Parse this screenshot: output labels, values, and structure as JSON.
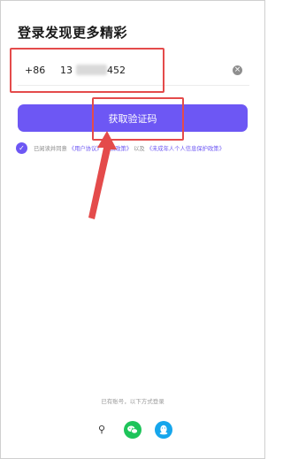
{
  "login": {
    "title": "登录发现更多精彩",
    "country_code": "+86",
    "phone_head": "13",
    "phone_tail": "452",
    "get_code_label": "获取验证码",
    "agreement": {
      "prefix": "已阅读并同意",
      "user_agreement": "《用户协议》",
      "privacy_policy": "隐私政策》",
      "and": "以及",
      "minor_policy": "《未成年人个人信息保护政策》"
    },
    "alt_login_hint": "已有账号，以下方式登录"
  },
  "colors": {
    "accent": "#6d57f4",
    "annotation_red": "#e44b4b",
    "wechat": "#1ec45a",
    "qq": "#16a6ec"
  },
  "icons": [
    "clear-icon",
    "check-icon",
    "key-icon",
    "wechat-icon",
    "qq-icon"
  ]
}
